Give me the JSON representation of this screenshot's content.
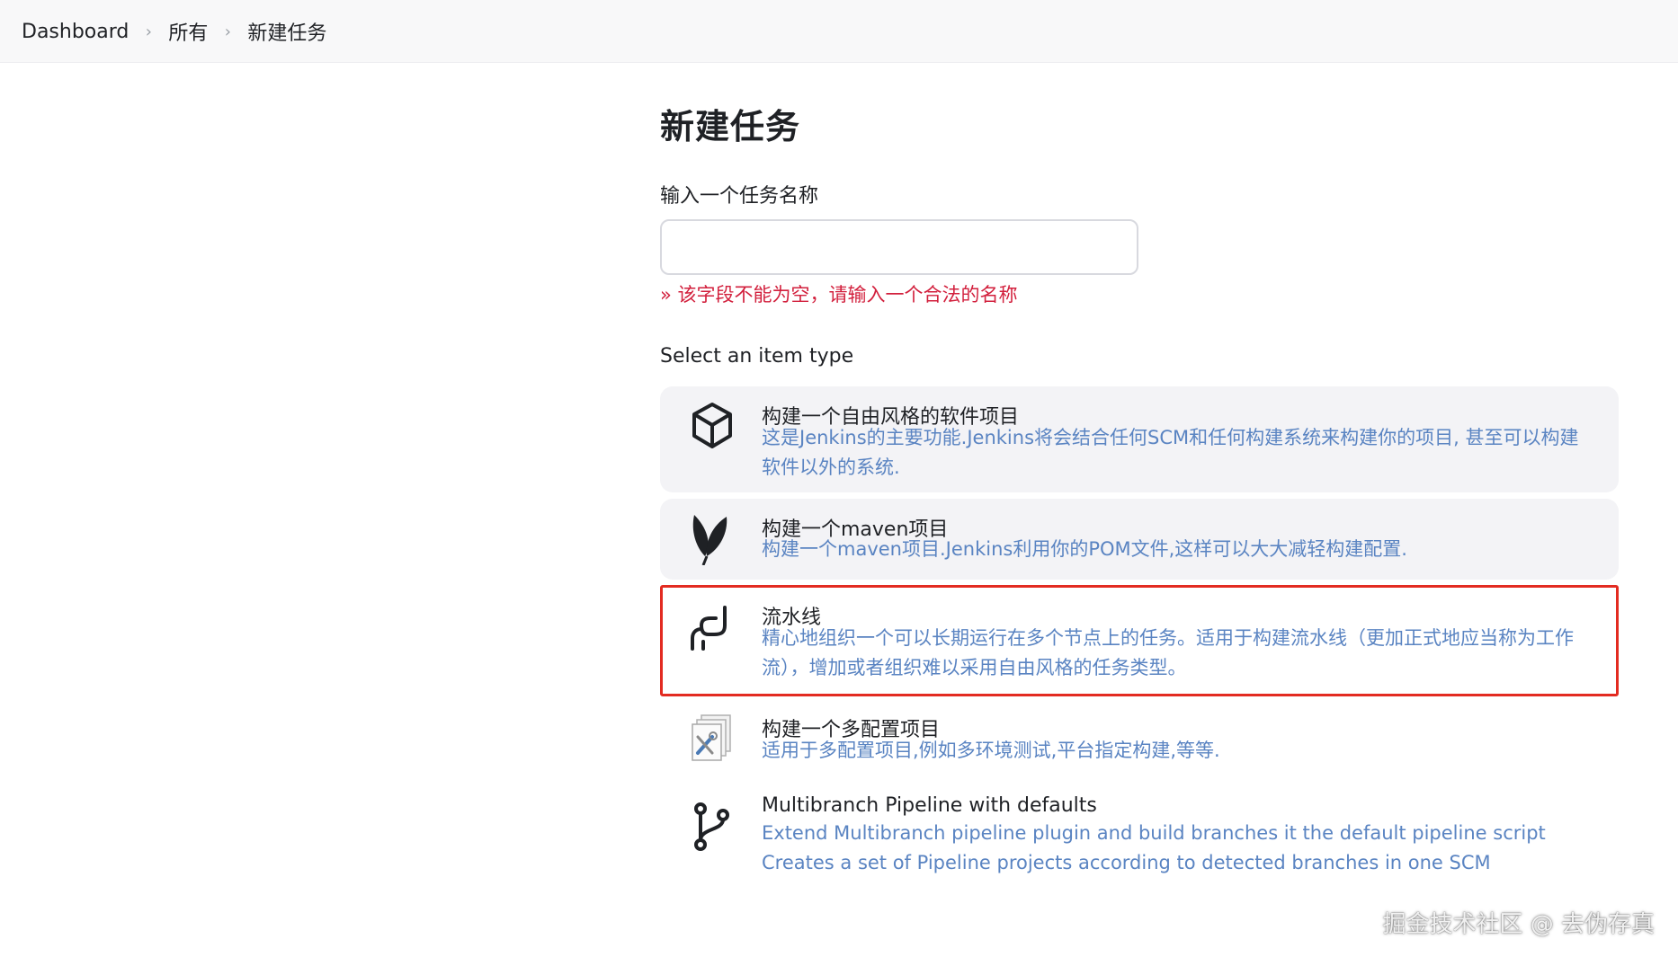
{
  "breadcrumb": {
    "items": [
      "Dashboard",
      "所有",
      "新建任务"
    ],
    "separator": "›"
  },
  "page": {
    "title": "新建任务",
    "name_label": "输入一个任务名称",
    "name_value": "",
    "name_placeholder": "",
    "error": "» 该字段不能为空，请输入一个合法的名称",
    "select_label": "Select an item type"
  },
  "items": [
    {
      "title": "构建一个自由风格的软件项目",
      "desc": "这是Jenkins的主要功能.Jenkins将会结合任何SCM和任何构建系统来构建你的项目, 甚至可以构建软件以外的系统.",
      "icon": "box-icon"
    },
    {
      "title": "构建一个maven项目",
      "desc": "构建一个maven项目.Jenkins利用你的POM文件,这样可以大大减轻构建配置.",
      "icon": "feather-icon"
    },
    {
      "title": "流水线",
      "desc": "精心地组织一个可以长期运行在多个节点上的任务。适用于构建流水线（更加正式地应当称为工作流），增加或者组织难以采用自由风格的任务类型。",
      "icon": "pipeline-icon"
    },
    {
      "title": "构建一个多配置项目",
      "desc": "适用于多配置项目,例如多环境测试,平台指定构建,等等.",
      "icon": "multi-config-icon"
    },
    {
      "title": "Multibranch Pipeline with defaults",
      "desc": "Extend Multibranch pipeline plugin and build branches it the default pipeline script Creates a set of Pipeline projects according to detected branches in one SCM",
      "icon": "branch-icon"
    }
  ],
  "colors": {
    "highlight_border": "#e32b21",
    "error_text": "#d21f3c",
    "desc_text": "#5a84c2",
    "card_bg": "#f3f3f6"
  },
  "watermark": "掘金技术社区 @ 去伪存真"
}
